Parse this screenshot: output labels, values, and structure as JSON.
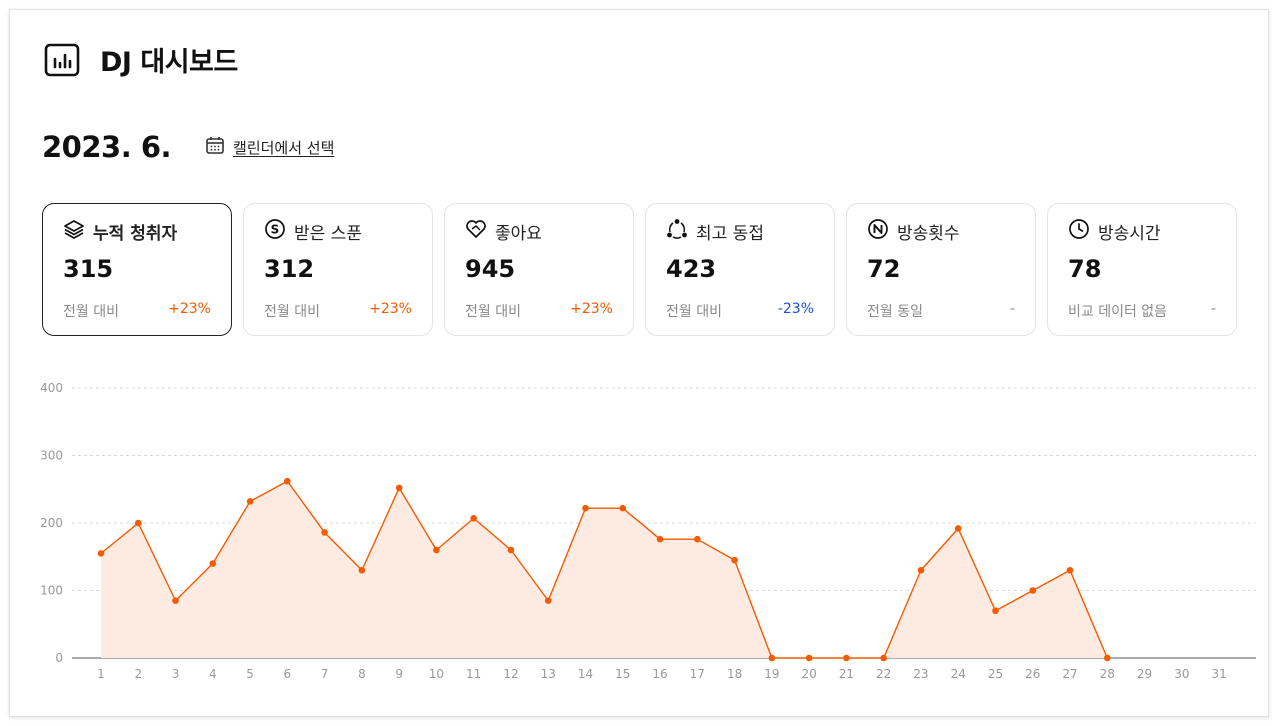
{
  "header": {
    "title": "DJ 대시보드",
    "icon": "bar-chart-icon"
  },
  "period": {
    "month": "2023. 6.",
    "calendar_label": "캘린더에서 선택",
    "icon": "calendar-icon"
  },
  "cards": [
    {
      "icon": "layers-icon",
      "label": "누적 청취자",
      "value": "315",
      "compare": "전월 대비",
      "change": "+23%",
      "trend": "up",
      "active": true
    },
    {
      "icon": "coin-icon",
      "label": "받은 스푼",
      "value": "312",
      "compare": "전월 대비",
      "change": "+23%",
      "trend": "up",
      "active": false
    },
    {
      "icon": "heart-icon",
      "label": "좋아요",
      "value": "945",
      "compare": "전월 대비",
      "change": "+23%",
      "trend": "up",
      "active": false
    },
    {
      "icon": "nodes-icon",
      "label": "최고 동접",
      "value": "423",
      "compare": "전월 대비",
      "change": "-23%",
      "trend": "down",
      "active": false
    },
    {
      "icon": "n-circle-icon",
      "label": "방송횟수",
      "value": "72",
      "compare": "전월 동일",
      "change": "-",
      "trend": "none",
      "active": false
    },
    {
      "icon": "clock-icon",
      "label": "방송시간",
      "value": "78",
      "compare": "비교 데이터 없음",
      "change": "-",
      "trend": "none",
      "active": false
    }
  ],
  "colors": {
    "accent": "#f45a00",
    "fill": "#fdebe1",
    "down": "#1f4fe0"
  },
  "chart_data": {
    "type": "area",
    "x": [
      1,
      2,
      3,
      4,
      5,
      6,
      7,
      8,
      9,
      10,
      11,
      12,
      13,
      14,
      15,
      16,
      17,
      18,
      19,
      20,
      21,
      22,
      23,
      24,
      25,
      26,
      27,
      28,
      29,
      30,
      31
    ],
    "series": [
      {
        "values": [
          155,
          200,
          85,
          140,
          232,
          262,
          186,
          130,
          252,
          160,
          207,
          160,
          85,
          222,
          222,
          176,
          176,
          145,
          0,
          0,
          0,
          0,
          130,
          192,
          70,
          100,
          130,
          0,
          null,
          null,
          null
        ]
      }
    ],
    "ylim": [
      0,
      400
    ],
    "yticks": [
      0,
      100,
      200,
      300,
      400
    ],
    "grid": true
  }
}
